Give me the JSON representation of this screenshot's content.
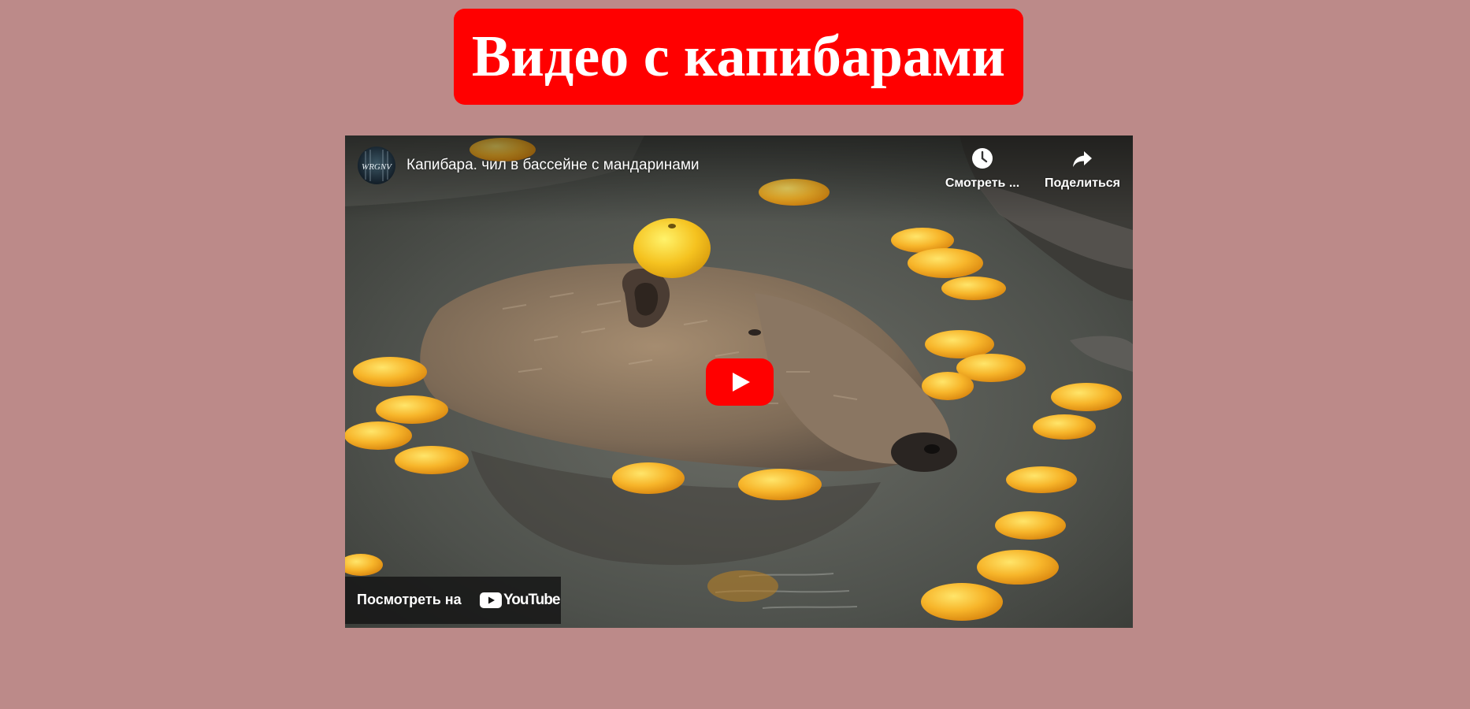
{
  "page": {
    "title": "Видео с капибарами",
    "background_color": "#bc8a89",
    "title_background_color": "#ff0000"
  },
  "video": {
    "title": "Капибара. чил в бассейне с мандаринами",
    "channel_avatar": "channel-avatar",
    "watch_later": {
      "label": "Смотреть ...",
      "icon": "clock-icon"
    },
    "share": {
      "label": "Поделиться",
      "icon": "share-arrow-icon"
    },
    "play_icon": "youtube-play-icon",
    "watch_on": {
      "label": "Посмотреть на",
      "brand": "YouTube",
      "icon": "youtube-logo-icon"
    },
    "brand_color": "#ff0000"
  }
}
